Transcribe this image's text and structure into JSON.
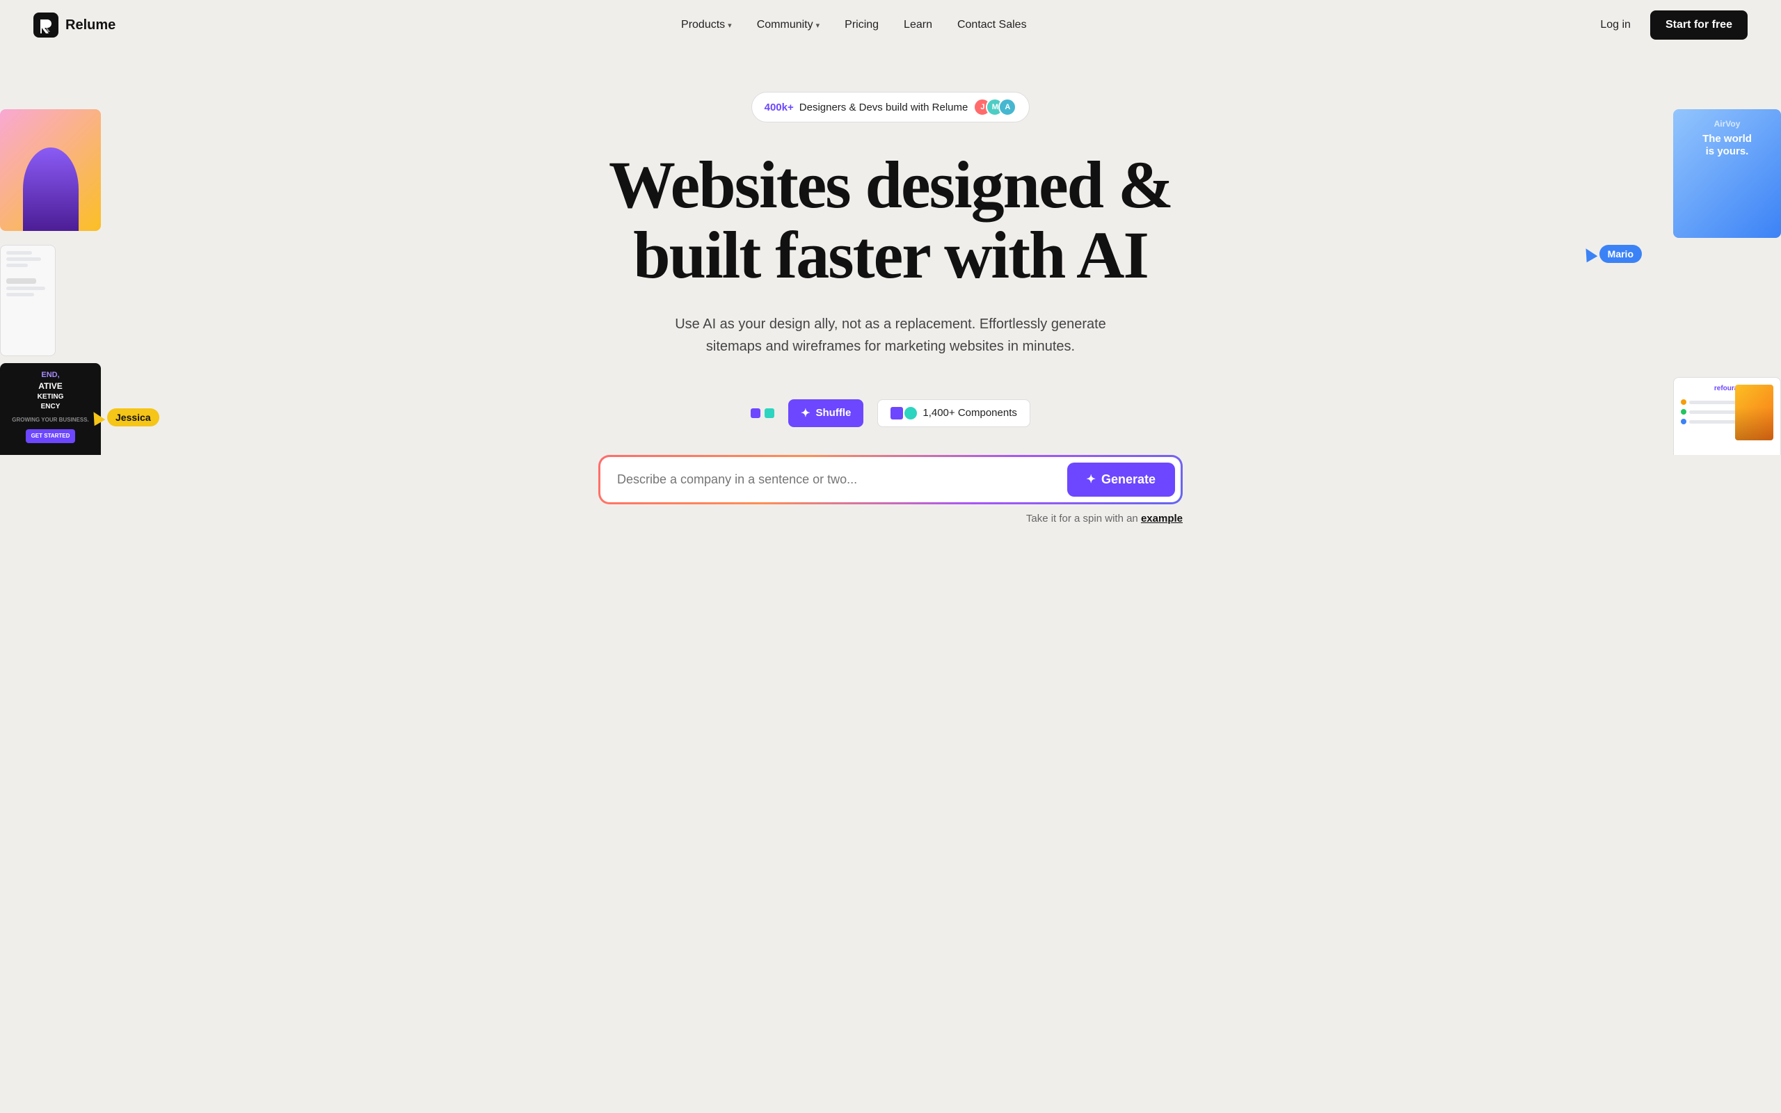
{
  "brand": {
    "name": "Relume",
    "logo_alt": "Relume logo"
  },
  "nav": {
    "items": [
      {
        "label": "Products",
        "has_dropdown": true
      },
      {
        "label": "Community",
        "has_dropdown": true
      },
      {
        "label": "Pricing",
        "has_dropdown": false
      },
      {
        "label": "Learn",
        "has_dropdown": false
      },
      {
        "label": "Contact Sales",
        "has_dropdown": false
      }
    ],
    "login_label": "Log in",
    "start_label": "Start for free"
  },
  "hero": {
    "badge_count": "400k+",
    "badge_text": "Designers & Devs build with Relume",
    "title_line1": "Websites designed &",
    "title_line2": "built faster with AI",
    "subtitle": "Use AI as your design ally, not as a replacement. Effortlessly generate sitemaps and wireframes for marketing websites in minutes.",
    "cursor_mario": "Mario",
    "cursor_jessica": "Jessica"
  },
  "toolbar": {
    "shuffle_label": "Shuffle",
    "components_label": "1,400+ Components"
  },
  "input": {
    "placeholder": "Describe a company in a sentence or two...",
    "generate_label": "Generate",
    "hint_text": "Take it for a spin with an",
    "hint_link": "example"
  },
  "screenshots": {
    "right_top_text": "The world is yours.",
    "left_bottom_text": "END, ATIVE KETING ENCY"
  },
  "colors": {
    "accent": "#6c47ff",
    "brand_dark": "#111111",
    "bg": "#f0eeeb"
  }
}
